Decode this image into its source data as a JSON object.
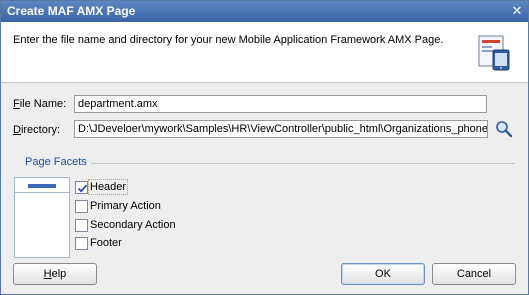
{
  "window": {
    "title": "Create MAF AMX Page"
  },
  "header": {
    "description": "Enter the file name and directory for your new Mobile Application Framework AMX Page."
  },
  "form": {
    "file_name_label_u": "F",
    "file_name_label_rest": "ile Name:",
    "file_name_value": "department.amx",
    "directory_label_u": "D",
    "directory_label_rest": "irectory:",
    "directory_value": "D:\\JDeveloer\\mywork\\Samples\\HR\\ViewController\\public_html\\Organizations_phone"
  },
  "facets": {
    "title": "Page Facets",
    "options": [
      {
        "label": "Header",
        "checked": true
      },
      {
        "label": "Primary Action",
        "checked": false
      },
      {
        "label": "Secondary Action",
        "checked": false
      },
      {
        "label": "Footer",
        "checked": false
      }
    ]
  },
  "buttons": {
    "help_u": "H",
    "help_rest": "elp",
    "ok": "OK",
    "cancel": "Cancel"
  }
}
